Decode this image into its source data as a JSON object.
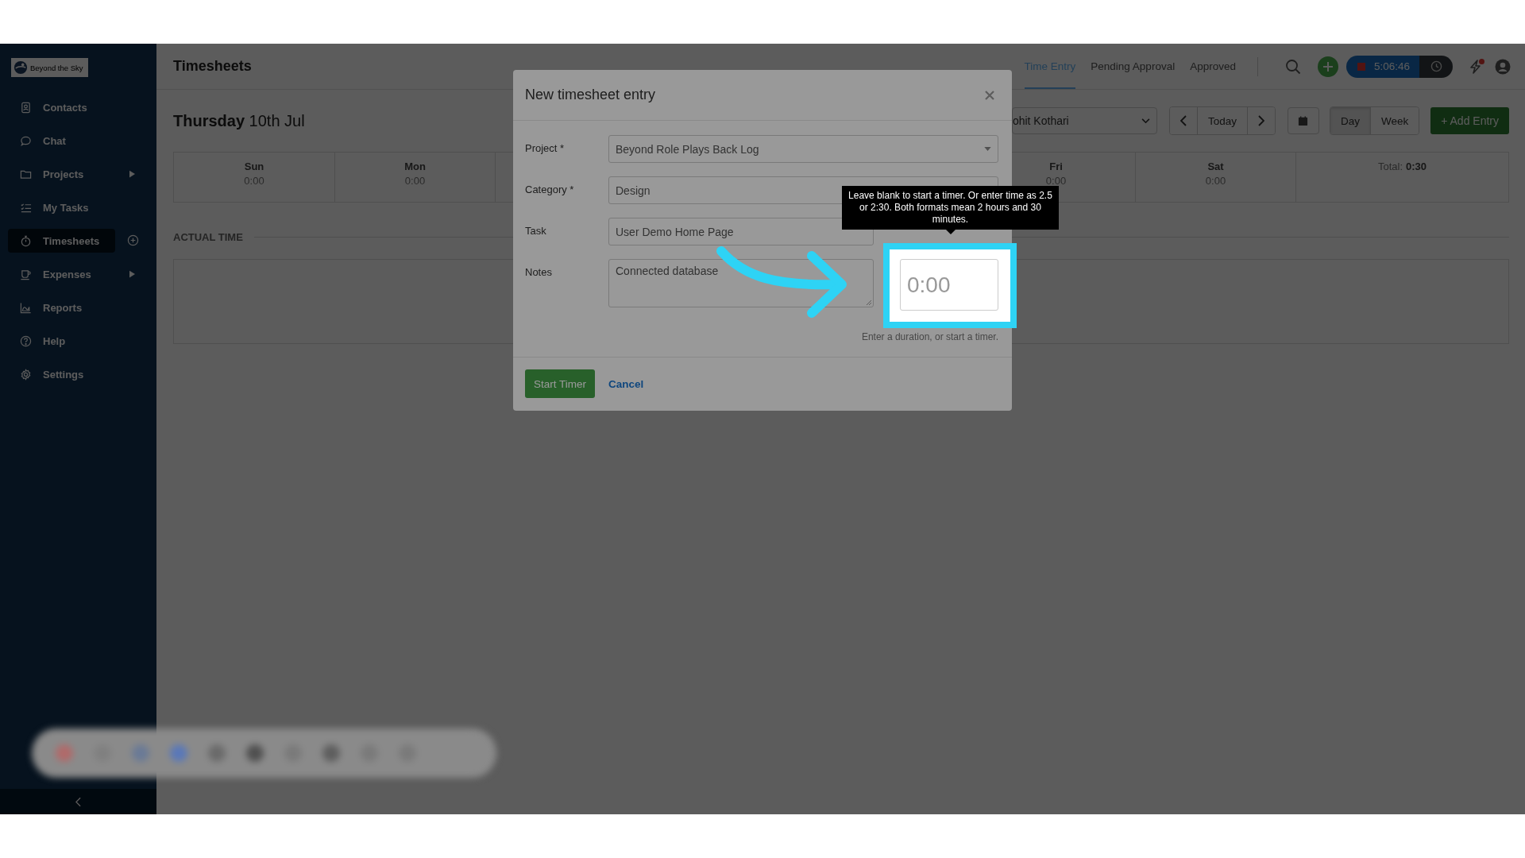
{
  "sidebar": {
    "logo": "Beyond the Sky",
    "items": [
      {
        "label": "Contacts",
        "selected": false,
        "submenu": false,
        "addable": false
      },
      {
        "label": "Chat",
        "selected": false,
        "submenu": false,
        "addable": false
      },
      {
        "label": "Projects",
        "selected": false,
        "submenu": true,
        "addable": false
      },
      {
        "label": "My Tasks",
        "selected": false,
        "submenu": false,
        "addable": false
      },
      {
        "label": "Timesheets",
        "selected": true,
        "submenu": false,
        "addable": true
      },
      {
        "label": "Expenses",
        "selected": false,
        "submenu": true,
        "addable": false
      },
      {
        "label": "Reports",
        "selected": false,
        "submenu": false,
        "addable": false
      },
      {
        "label": "Help",
        "selected": false,
        "submenu": false,
        "addable": false
      },
      {
        "label": "Settings",
        "selected": false,
        "submenu": false,
        "addable": false
      }
    ]
  },
  "header": {
    "title": "Timesheets",
    "tabs": [
      {
        "label": "Time Entry",
        "selected": true
      },
      {
        "label": "Pending Approval",
        "selected": false
      },
      {
        "label": "Approved",
        "selected": false
      }
    ],
    "timer": "5:06:46",
    "alert": true
  },
  "toolbar": {
    "date": "**Thursday** 10th Jul",
    "user": "ohit Kothari",
    "today": "Today",
    "views": [
      {
        "label": "Day",
        "selected": true
      },
      {
        "label": "Week",
        "selected": false
      }
    ],
    "add_entry": "+ Add Entry"
  },
  "days": [
    {
      "day": "Sun",
      "total": "0:00"
    },
    {
      "day": "Mon",
      "total": "0:00"
    },
    {
      "day": "Fri",
      "total": "0:00"
    },
    {
      "day": "Sat",
      "total": "0:00"
    }
  ],
  "total": {
    "label": "Total:",
    "value": "0:30"
  },
  "section": "ACTUAL TIME",
  "modal": {
    "title": "New timesheet entry",
    "fields": [
      {
        "label": "Project *",
        "value": "Beyond Role Plays Back Log",
        "kind": "select"
      },
      {
        "label": "Category *",
        "value": "Design",
        "kind": "select"
      },
      {
        "label": "Task",
        "value": "User Demo Home Page",
        "kind": "text"
      },
      {
        "label": "Notes",
        "value": "Connected database",
        "kind": "textarea"
      }
    ],
    "time": {
      "placeholder": "0:00"
    },
    "hint": "Enter a duration, or start a timer.",
    "tooltip": "Leave blank to start a timer. Or enter time as 2.5 or 2:30. Both formats mean 2 hours and 30 minutes.",
    "primary": "Start Timer",
    "cancel": "Cancel"
  }
}
